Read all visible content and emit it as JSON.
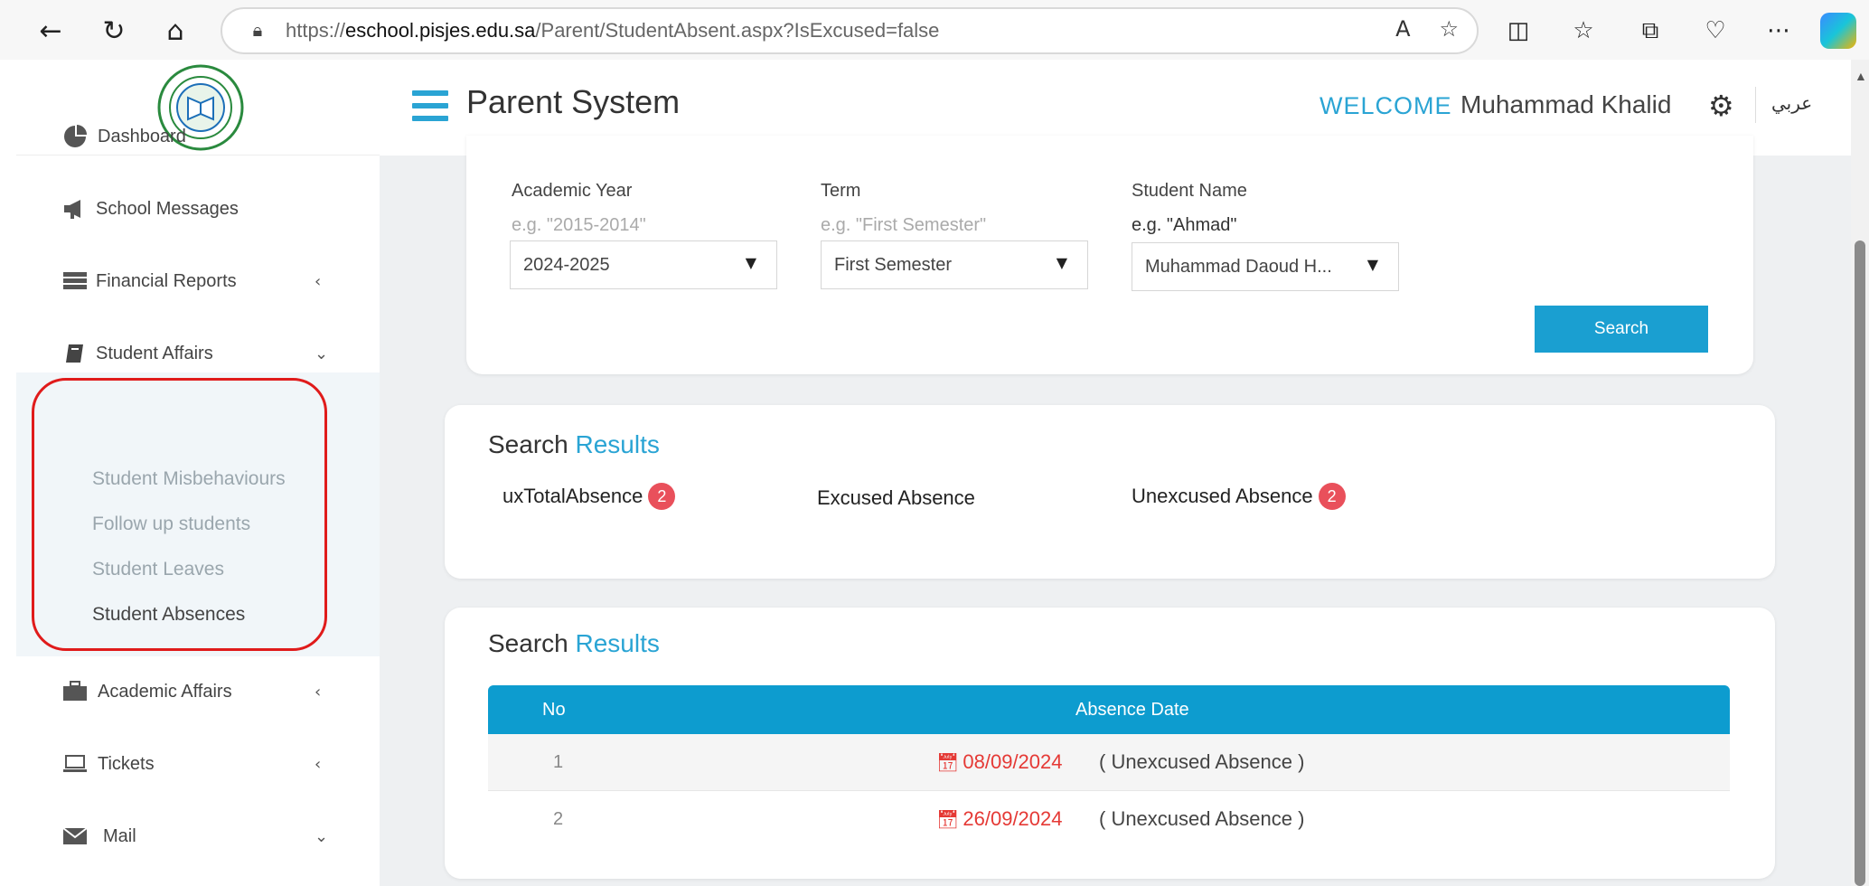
{
  "browser": {
    "url_prefix": "https://",
    "url_host": "eschool.pisjes.edu.sa",
    "url_path": "/Parent/StudentAbsent.aspx?IsExcused=false"
  },
  "header": {
    "app_title": "Parent System",
    "welcome": "WELCOME",
    "user_name": "Muhammad Khalid",
    "language": "عربي"
  },
  "sidebar": {
    "items": [
      {
        "label": "Dashboard",
        "icon": "pie-chart-icon"
      },
      {
        "label": "School Messages",
        "icon": "megaphone-icon"
      },
      {
        "label": "Financial Reports",
        "icon": "server-icon"
      },
      {
        "label": "Student Affairs",
        "icon": "book-icon"
      },
      {
        "label": "Academic Affairs",
        "icon": "briefcase-icon"
      },
      {
        "label": "Tickets",
        "icon": "laptop-icon"
      },
      {
        "label": "Mail",
        "icon": "envelope-icon"
      }
    ],
    "student_affairs_sub": [
      {
        "label": "Student Misbehaviours"
      },
      {
        "label": "Follow up students"
      },
      {
        "label": "Student Leaves"
      },
      {
        "label": "Student Absences"
      }
    ]
  },
  "filters": {
    "academic_year": {
      "label": "Academic Year",
      "hint": "e.g. \"2015-2014\"",
      "value": "2024-2025"
    },
    "term": {
      "label": "Term",
      "hint": "e.g. \"First Semester\"",
      "value": "First Semester"
    },
    "student_name": {
      "label": "Student Name",
      "hint": "e.g. \"Ahmad\"",
      "value": "Muhammad Daoud H..."
    },
    "search_label": "Search"
  },
  "summary": {
    "title_part1": "Search",
    "title_part2": "Results",
    "total_label": "uxTotalAbsence",
    "total_count": "2",
    "excused_label": "Excused Absence",
    "unexcused_label": "Unexcused Absence",
    "unexcused_count": "2"
  },
  "results": {
    "title_part1": "Search",
    "title_part2": "Results",
    "columns": [
      "No",
      "Absence Date"
    ],
    "rows": [
      {
        "no": "1",
        "date": "08/09/2024",
        "type": "( Unexcused Absence )"
      },
      {
        "no": "2",
        "date": "26/09/2024",
        "type": "( Unexcused Absence )"
      }
    ]
  },
  "colors": {
    "accent": "#2aa4d4",
    "table_header": "#0d9ccf",
    "badge": "#e9505b",
    "absence_date": "#e53935",
    "highlight": "#e01b1b"
  }
}
